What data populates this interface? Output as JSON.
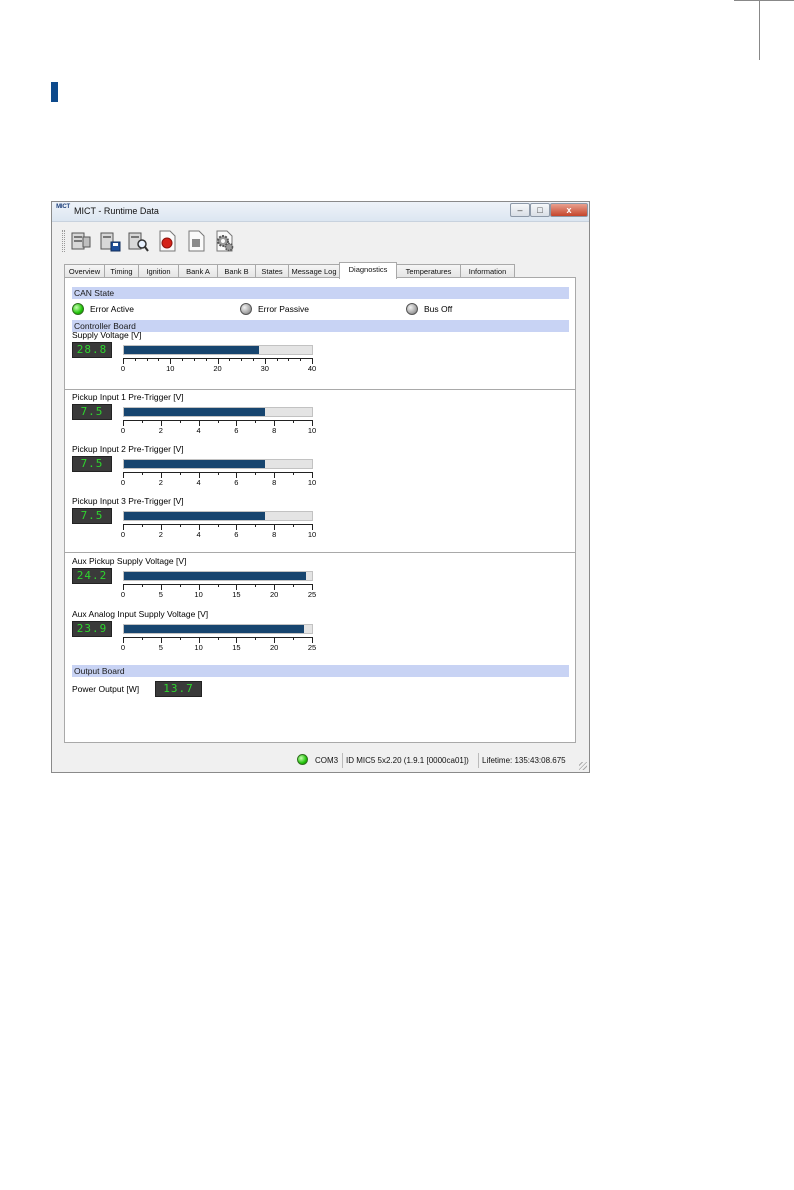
{
  "window": {
    "logo_text": "MICT",
    "title": "MICT - Runtime Data"
  },
  "titlebar_buttons": {
    "minimize": "–",
    "maximize": "□",
    "close": "x"
  },
  "toolbar_icons": [
    "read-computer-icon",
    "save-computer-icon",
    "search-computer-icon",
    "record-icon",
    "stop-icon",
    "settings-gears-icon"
  ],
  "tabs": [
    {
      "label": "Overview",
      "active": false
    },
    {
      "label": "Timing",
      "active": false
    },
    {
      "label": "Ignition",
      "active": false
    },
    {
      "label": "Bank A",
      "active": false
    },
    {
      "label": "Bank B",
      "active": false
    },
    {
      "label": "States",
      "active": false
    },
    {
      "label": "Message Log",
      "active": false
    },
    {
      "label": "Diagnostics",
      "active": true
    },
    {
      "label": "Temperatures",
      "active": false
    },
    {
      "label": "Information",
      "active": false
    }
  ],
  "can_state": {
    "header": "CAN State",
    "indicators": [
      {
        "label": "Error Active",
        "state": "green"
      },
      {
        "label": "Error Passive",
        "state": "gray"
      },
      {
        "label": "Bus Off",
        "state": "gray"
      }
    ]
  },
  "controller_board": {
    "header": "Controller Board",
    "meters": [
      {
        "label": "Supply Voltage [V]",
        "display": "28.8",
        "value": 28.8,
        "max": 40,
        "ticks": [
          "0",
          "10",
          "20",
          "30",
          "40"
        ]
      },
      {
        "label": "Pickup Input 1 Pre-Trigger [V]",
        "display": "7.5",
        "value": 7.5,
        "max": 10,
        "ticks": [
          "0",
          "2",
          "4",
          "6",
          "8",
          "10"
        ]
      },
      {
        "label": "Pickup Input 2 Pre-Trigger [V]",
        "display": "7.5",
        "value": 7.5,
        "max": 10,
        "ticks": [
          "0",
          "2",
          "4",
          "6",
          "8",
          "10"
        ]
      },
      {
        "label": "Pickup Input 3 Pre-Trigger [V]",
        "display": "7.5",
        "value": 7.5,
        "max": 10,
        "ticks": [
          "0",
          "2",
          "4",
          "6",
          "8",
          "10"
        ]
      },
      {
        "label": "Aux Pickup Supply Voltage [V]",
        "display": "24.2",
        "value": 24.2,
        "max": 25,
        "ticks": [
          "0",
          "5",
          "10",
          "15",
          "20",
          "25"
        ]
      },
      {
        "label": "Aux Analog Input Supply Voltage [V]",
        "display": "23.9",
        "value": 23.9,
        "max": 25,
        "ticks": [
          "0",
          "5",
          "10",
          "15",
          "20",
          "25"
        ]
      }
    ]
  },
  "output_board": {
    "header": "Output Board",
    "power_label": "Power Output [W]",
    "power_display": "13.7"
  },
  "status": {
    "port": "COM3",
    "device": "ID MIC5 5x2.20 (1.9.1 [0000ca01])",
    "lifetime": "Lifetime: 135:43:08.675"
  },
  "colors": {
    "section_header": "#c8d3f4",
    "bar_fill": "#17456f",
    "lcd_digits": "#2ed52e",
    "accent_marker": "#0d4a8c"
  }
}
